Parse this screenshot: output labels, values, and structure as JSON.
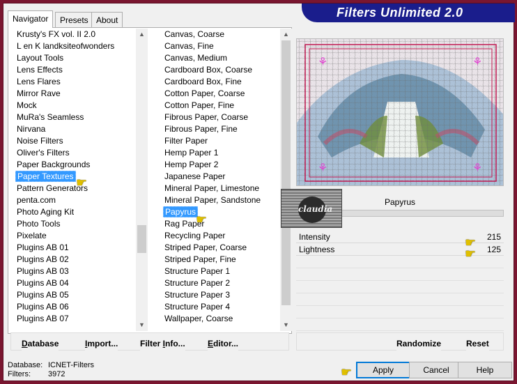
{
  "window": {
    "title": "Filters Unlimited 2.0"
  },
  "tabs": [
    {
      "label": "Navigator"
    },
    {
      "label": "Presets"
    },
    {
      "label": "About"
    }
  ],
  "categories": {
    "items": [
      "Krusty's FX vol. II 2.0",
      "L en K landksiteofwonders",
      "Layout Tools",
      "Lens Effects",
      "Lens Flares",
      "Mirror Rave",
      "Mock",
      "MuRa's Seamless",
      "Nirvana",
      "Noise Filters",
      "Oliver's Filters",
      "Paper Backgrounds",
      "Paper Textures",
      "Pattern Generators",
      "penta.com",
      "Photo Aging Kit",
      "Photo Tools",
      "Pixelate",
      "Plugins AB 01",
      "Plugins AB 02",
      "Plugins AB 03",
      "Plugins AB 04",
      "Plugins AB 05",
      "Plugins AB 06",
      "Plugins AB 07"
    ],
    "selected": "Paper Textures"
  },
  "filters": {
    "items": [
      "Canvas, Coarse",
      "Canvas, Fine",
      "Canvas, Medium",
      "Cardboard Box, Coarse",
      "Cardboard Box, Fine",
      "Cotton Paper, Coarse",
      "Cotton Paper, Fine",
      "Fibrous Paper, Coarse",
      "Fibrous Paper, Fine",
      "Filter Paper",
      "Hemp Paper 1",
      "Hemp Paper 2",
      "Japanese Paper",
      "Mineral Paper, Limestone",
      "Mineral Paper, Sandstone",
      "Papyrus",
      "Rag Paper",
      "Recycling Paper",
      "Striped Paper, Coarse",
      "Striped Paper, Fine",
      "Structure Paper 1",
      "Structure Paper 2",
      "Structure Paper 3",
      "Structure Paper 4",
      "Wallpaper, Coarse"
    ],
    "selected": "Papyrus"
  },
  "preview": {
    "filter_name": "Papyrus",
    "watermark": "claudia"
  },
  "params": [
    {
      "label": "Intensity",
      "value": "215"
    },
    {
      "label": "Lightness",
      "value": "125"
    }
  ],
  "toolbar": {
    "database": {
      "u": "D",
      "rest": "atabase"
    },
    "import": {
      "u": "I",
      "rest": "mport..."
    },
    "filter_info": {
      "pre": "Filter ",
      "u": "I",
      "rest": "nfo..."
    },
    "editor": {
      "u": "E",
      "rest": "ditor..."
    },
    "randomize": "Randomize",
    "reset": "Reset"
  },
  "status": {
    "database_label": "Database:",
    "database_value": "ICNET-Filters",
    "filters_label": "Filters:",
    "filters_value": "3972"
  },
  "buttons": {
    "apply": "Apply",
    "cancel": "Cancel",
    "help": "Help"
  },
  "colors": {
    "accent": "#1a1d8c",
    "frame": "#7a1630",
    "selection": "#3399ff"
  }
}
